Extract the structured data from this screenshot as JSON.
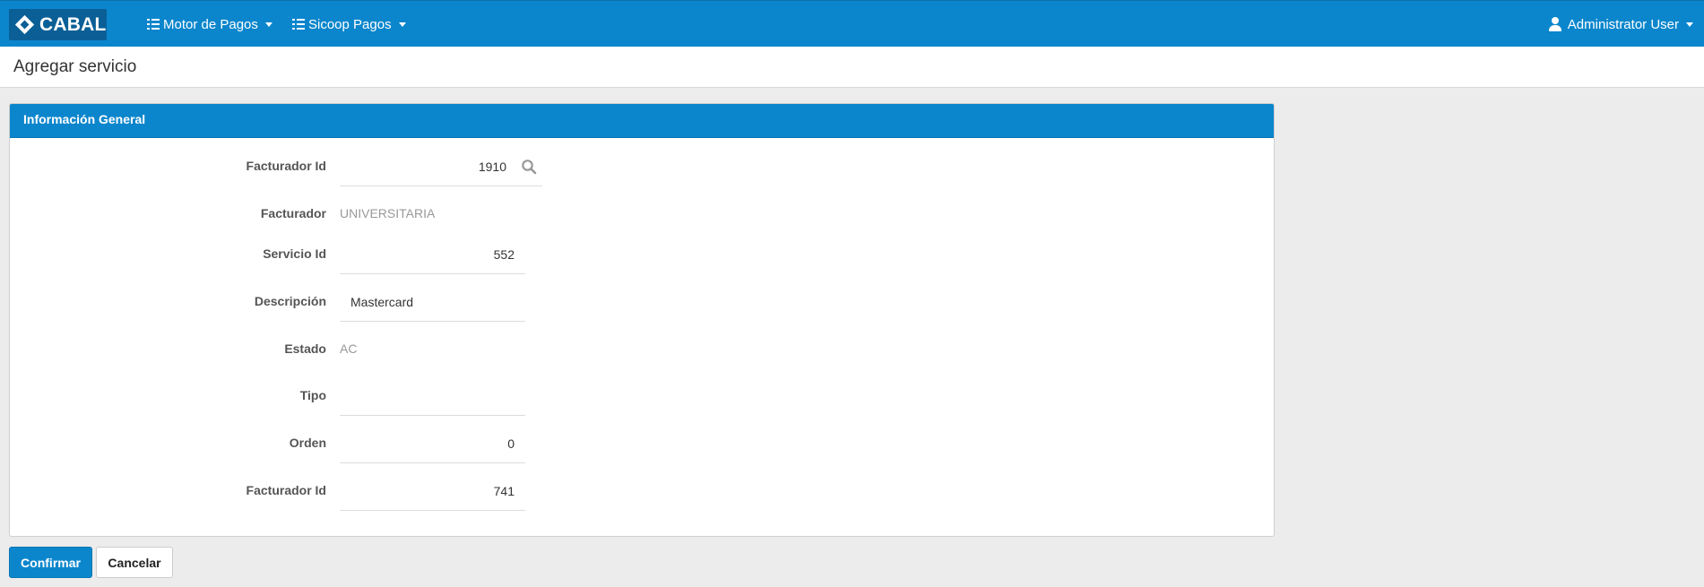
{
  "navbar": {
    "brand": "CABAL",
    "menus": [
      {
        "label": "Motor de Pagos"
      },
      {
        "label": "Sicoop Pagos"
      }
    ],
    "user": "Administrator User"
  },
  "page": {
    "title": "Agregar servicio"
  },
  "panel": {
    "heading": "Información General",
    "fields": {
      "facturador_id": {
        "label": "Facturador Id",
        "value": "1910"
      },
      "facturador": {
        "label": "Facturador",
        "value": "UNIVERSITARIA"
      },
      "servicio_id": {
        "label": "Servicio Id",
        "value": "552"
      },
      "descripcion": {
        "label": "Descripción",
        "value": "Mastercard"
      },
      "estado": {
        "label": "Estado",
        "value": "AC"
      },
      "tipo": {
        "label": "Tipo",
        "value": ""
      },
      "orden": {
        "label": "Orden",
        "value": "0"
      },
      "facturador_id_2": {
        "label": "Facturador Id",
        "value": "741"
      }
    }
  },
  "buttons": {
    "confirm": "Confirmar",
    "cancel": "Cancelar"
  },
  "colors": {
    "primary": "#0b86cc",
    "brand_bg": "#0a5f96",
    "background": "#ececec"
  }
}
